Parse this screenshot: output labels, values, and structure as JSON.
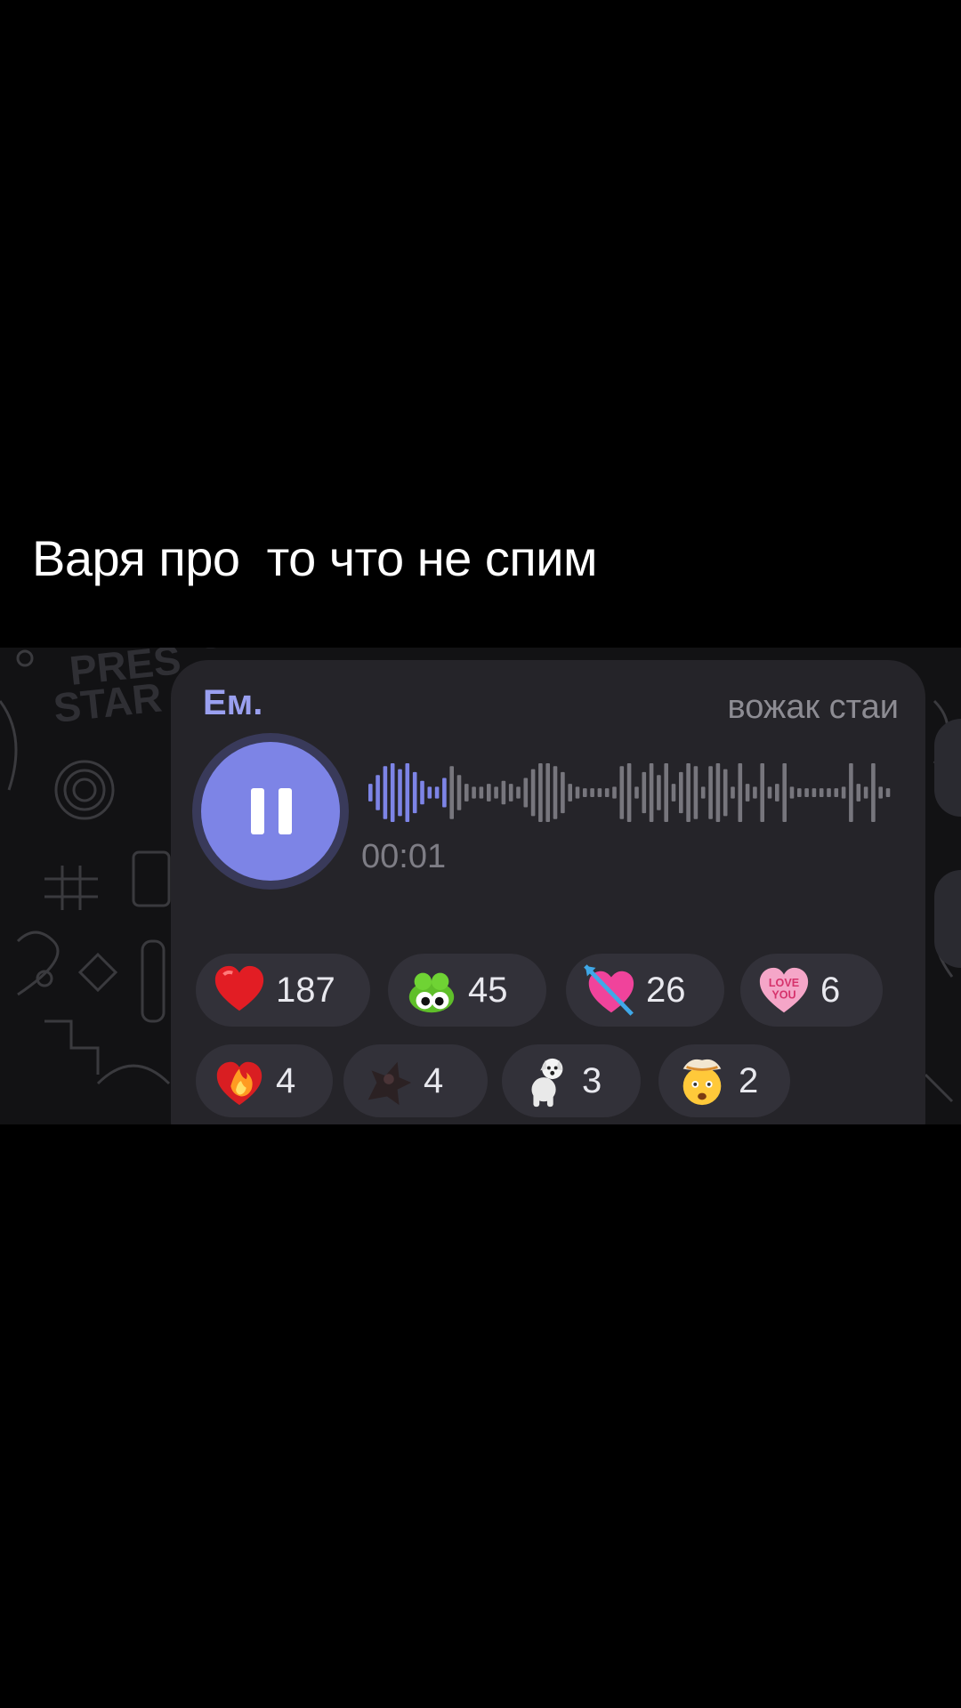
{
  "caption": "Варя про  то что не спим",
  "message": {
    "sender": "Ем.",
    "forward_label": "вожак стаи",
    "duration": "00:01",
    "playing": true,
    "progress": 0.16
  },
  "colors": {
    "accent": "#7d84e6",
    "sender": "#9aa0f0",
    "bubble": "#252429",
    "chip": "#323139"
  },
  "reactions": [
    {
      "icon": "red-heart-icon",
      "count": "187"
    },
    {
      "icon": "green-frog-icon",
      "count": "45"
    },
    {
      "icon": "heart-with-arrow-icon",
      "count": "26"
    },
    {
      "icon": "love-you-heart-icon",
      "count": "6"
    },
    {
      "icon": "heart-on-fire-icon",
      "count": "4"
    },
    {
      "icon": "dark-sticker-icon",
      "count": "4"
    },
    {
      "icon": "white-dog-icon",
      "count": "3"
    },
    {
      "icon": "exploding-head-icon",
      "count": "2"
    }
  ]
}
